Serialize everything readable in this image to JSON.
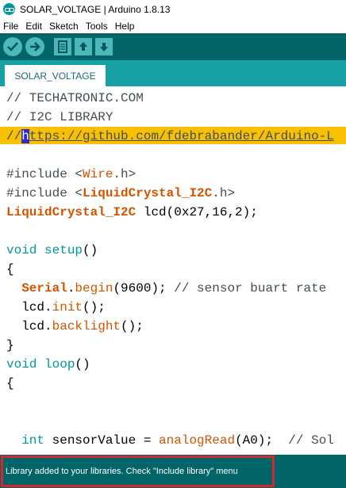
{
  "window": {
    "title": "SOLAR_VOLTAGE | Arduino 1.8.13"
  },
  "menubar": {
    "items": [
      "File",
      "Edit",
      "Sketch",
      "Tools",
      "Help"
    ]
  },
  "toolbar": {
    "buttons": [
      "verify-icon",
      "upload-icon",
      "new-icon",
      "open-icon",
      "save-icon"
    ]
  },
  "tabs": [
    {
      "label": "SOLAR_VOLTAGE"
    }
  ],
  "editor": {
    "lines": [
      "// TECHATRONIC.COM",
      "// I2C LIBRARY",
      "//https://github.com/fdebrabander/Arduino-L",
      "",
      "#include <Wire.h>",
      "#include <LiquidCrystal_I2C.h>",
      "LiquidCrystal_I2C lcd(0x27,16,2);",
      "",
      "void setup()",
      "{",
      "  Serial.begin(9600); // sensor buart rate",
      "  lcd.init();",
      "  lcd.backlight();",
      "}",
      "void loop()",
      "{",
      "",
      "",
      "  int sensorValue = analogRead(A0);  // Sol"
    ]
  },
  "colors": {
    "toolbar": "#006468",
    "tabbar": "#17a1a5",
    "highlight": "#f8c000",
    "status_border": "#d9262b"
  },
  "status": {
    "message": "Library added to your libraries. Check \"Include library\" menu"
  }
}
